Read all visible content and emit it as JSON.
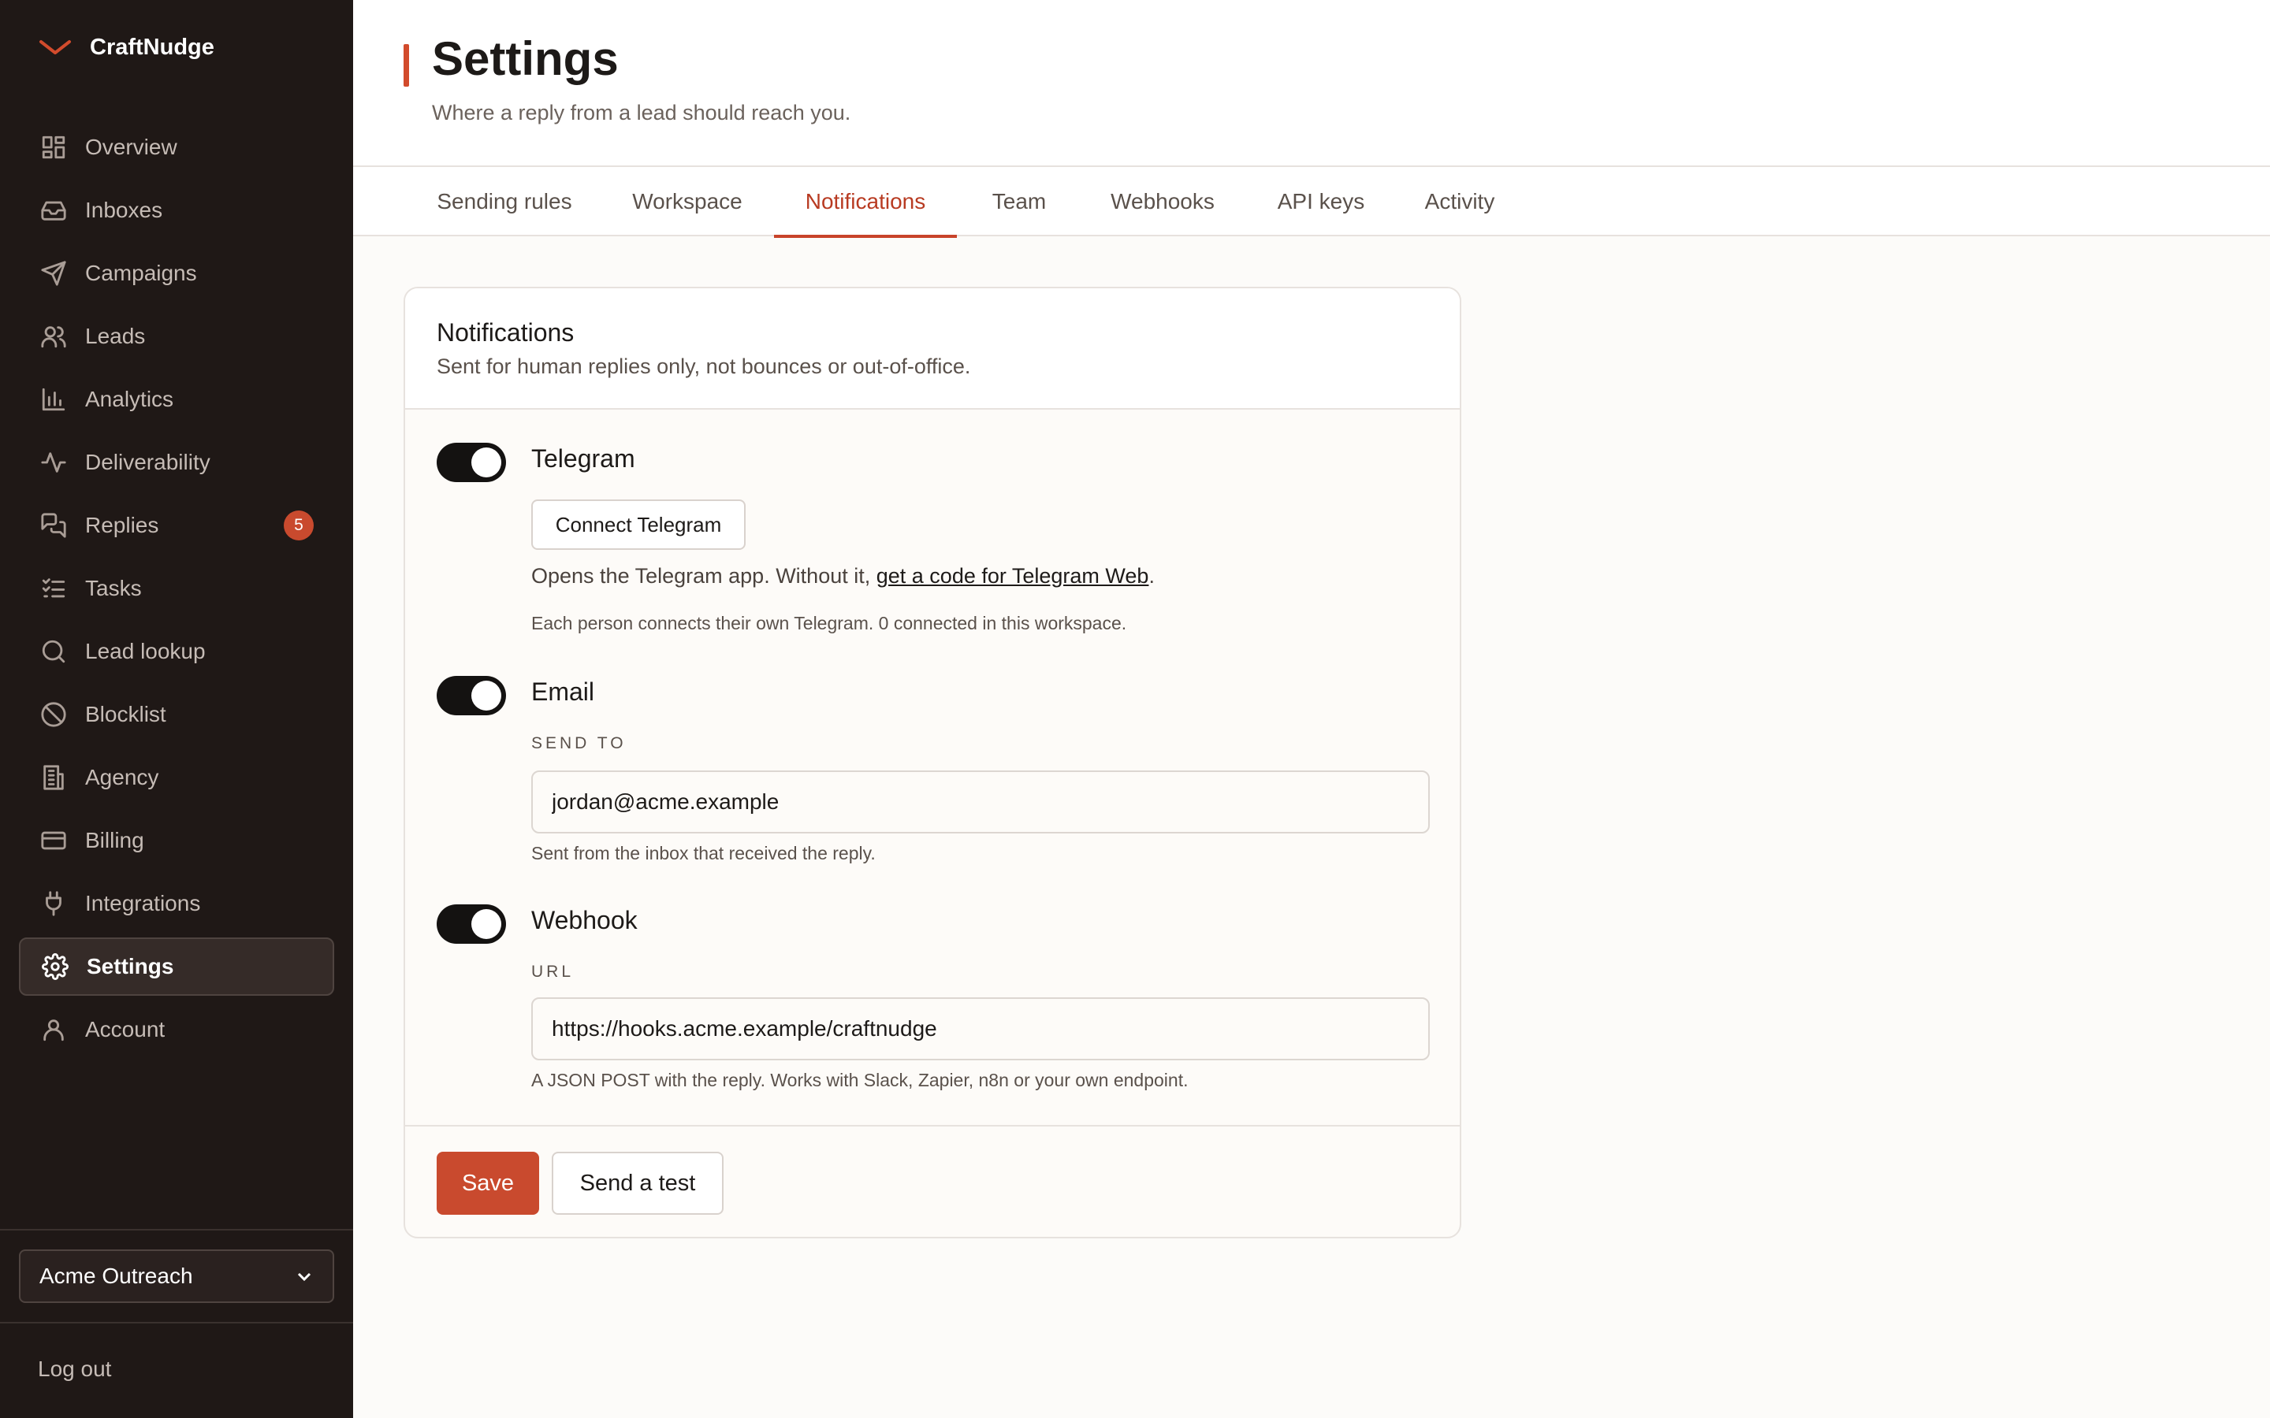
{
  "brand": {
    "name": "CraftNudge",
    "accent": "#d24b2c"
  },
  "sidebar": {
    "items": [
      {
        "label": "Overview",
        "icon": "grid-icon"
      },
      {
        "label": "Inboxes",
        "icon": "inbox-icon"
      },
      {
        "label": "Campaigns",
        "icon": "send-icon"
      },
      {
        "label": "Leads",
        "icon": "users-icon"
      },
      {
        "label": "Analytics",
        "icon": "bar-chart-icon"
      },
      {
        "label": "Deliverability",
        "icon": "pulse-icon"
      },
      {
        "label": "Replies",
        "icon": "chat-icon",
        "badge": "5"
      },
      {
        "label": "Tasks",
        "icon": "checklist-icon"
      },
      {
        "label": "Lead lookup",
        "icon": "search-icon"
      },
      {
        "label": "Blocklist",
        "icon": "ban-icon"
      },
      {
        "label": "Agency",
        "icon": "building-icon"
      },
      {
        "label": "Billing",
        "icon": "credit-card-icon"
      },
      {
        "label": "Integrations",
        "icon": "plug-icon"
      },
      {
        "label": "Settings",
        "icon": "gear-icon",
        "active": true
      },
      {
        "label": "Account",
        "icon": "user-icon"
      }
    ],
    "workspace": "Acme Outreach",
    "logout": "Log out"
  },
  "header": {
    "title": "Settings",
    "subtitle": "Where a reply from a lead should reach you."
  },
  "tabs": [
    {
      "label": "Sending rules"
    },
    {
      "label": "Workspace"
    },
    {
      "label": "Notifications",
      "active": true
    },
    {
      "label": "Team"
    },
    {
      "label": "Webhooks"
    },
    {
      "label": "API keys"
    },
    {
      "label": "Activity"
    }
  ],
  "card": {
    "title": "Notifications",
    "subtitle": "Sent for human replies only, not bounces or out-of-office.",
    "telegram": {
      "name": "Telegram",
      "enabled": true,
      "connect_label": "Connect Telegram",
      "help_prefix": "Opens the Telegram app. Without it, ",
      "help_link": "get a code for Telegram Web",
      "help_suffix": ".",
      "note": "Each person connects their own Telegram. 0 connected in this workspace."
    },
    "email": {
      "name": "Email",
      "enabled": true,
      "field_label": "SEND TO",
      "value": "jordan@acme.example",
      "note": "Sent from the inbox that received the reply."
    },
    "webhook": {
      "name": "Webhook",
      "enabled": true,
      "field_label": "URL",
      "value": "https://hooks.acme.example/craftnudge",
      "note": "A JSON POST with the reply. Works with Slack, Zapier, n8n or your own endpoint."
    },
    "save_label": "Save",
    "test_label": "Send a test"
  }
}
